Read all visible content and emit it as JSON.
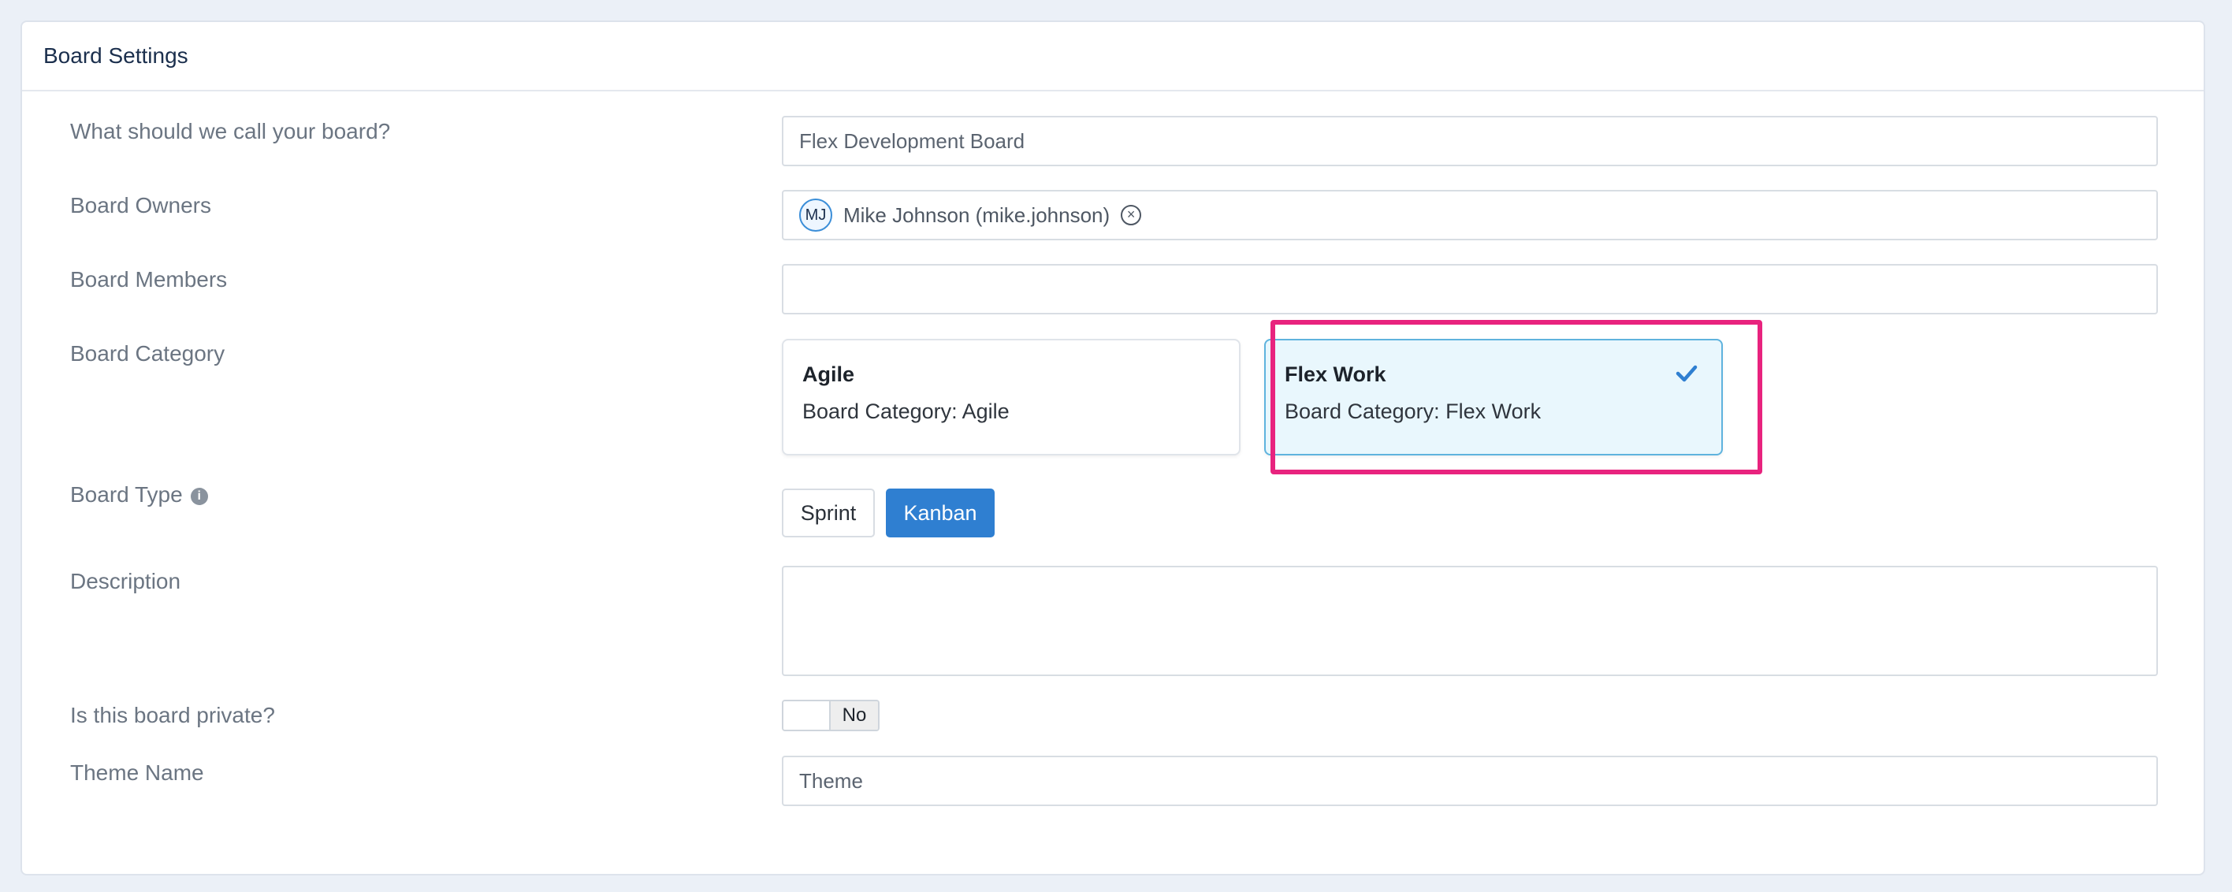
{
  "card": {
    "title": "Board Settings"
  },
  "form": {
    "name_label": "What should we call your board?",
    "name_value": "Flex Development Board",
    "owners_label": "Board Owners",
    "owner": {
      "initials": "MJ",
      "name": "Mike Johnson (mike.johnson)"
    },
    "members_label": "Board Members",
    "members_value": "",
    "category_label": "Board Category",
    "categories": [
      {
        "title": "Agile",
        "description": "Board Category: Agile",
        "selected": false
      },
      {
        "title": "Flex Work",
        "description": "Board Category: Flex Work",
        "selected": true
      }
    ],
    "type_label": "Board Type",
    "type_options": [
      {
        "label": "Sprint",
        "selected": false
      },
      {
        "label": "Kanban",
        "selected": true
      }
    ],
    "description_label": "Description",
    "description_value": "",
    "private_label": "Is this board private?",
    "private_value": "No",
    "theme_label": "Theme Name",
    "theme_placeholder": "Theme"
  },
  "colors": {
    "accent": "#2f7fd1",
    "highlight": "#e8237e",
    "selected_bg": "#e9f7fd"
  }
}
